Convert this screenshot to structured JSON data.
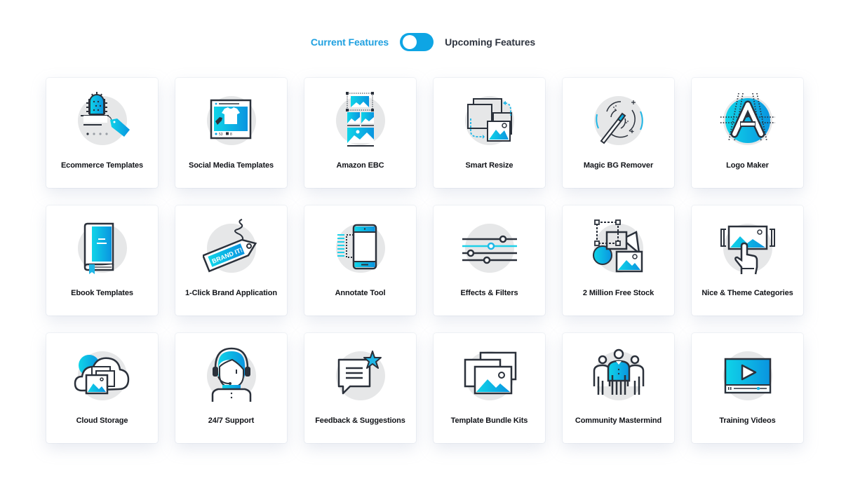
{
  "toggle": {
    "current_label": "Current Features",
    "upcoming_label": "Upcoming Features",
    "state": "current"
  },
  "colors": {
    "accent": "#1fa0e0",
    "switch": "#0ea5e4",
    "icon_gradient_start": "#0fd4e8",
    "icon_gradient_end": "#0a94e0",
    "icon_stroke": "#2b313b",
    "icon_circle": "#e6e7e8"
  },
  "features": [
    {
      "label": "Ecommerce Templates",
      "icon": "cactus-price-tag-icon"
    },
    {
      "label": "Social Media Templates",
      "icon": "social-post-tshirt-icon",
      "likes": "53",
      "comments": "8"
    },
    {
      "label": "Amazon EBC",
      "icon": "image-layout-blocks-icon"
    },
    {
      "label": "Smart Resize",
      "icon": "resize-frames-icon"
    },
    {
      "label": "Magic BG Remover",
      "icon": "magic-wand-icon"
    },
    {
      "label": "Logo Maker",
      "icon": "letter-a-logo-icon"
    },
    {
      "label": "Ebook Templates",
      "icon": "book-icon"
    },
    {
      "label": "1-Click Brand Application",
      "icon": "brand-tag-icon",
      "tag_text": "BRAND IT!"
    },
    {
      "label": "Annotate Tool",
      "icon": "phone-annotate-icon"
    },
    {
      "label": "Effects & Filters",
      "icon": "sliders-icon"
    },
    {
      "label": "2 Million Free Stock",
      "icon": "stock-shapes-icon"
    },
    {
      "label": "Nice & Theme Categories",
      "icon": "touch-gallery-icon"
    },
    {
      "label": "Cloud Storage",
      "icon": "cloud-images-icon"
    },
    {
      "label": "24/7 Support",
      "icon": "headset-agent-icon"
    },
    {
      "label": "Feedback & Suggestions",
      "icon": "chat-star-icon"
    },
    {
      "label": "Template Bundle Kits",
      "icon": "stacked-images-icon"
    },
    {
      "label": "Community Mastermind",
      "icon": "team-people-icon"
    },
    {
      "label": "Training Videos",
      "icon": "video-player-icon"
    }
  ]
}
